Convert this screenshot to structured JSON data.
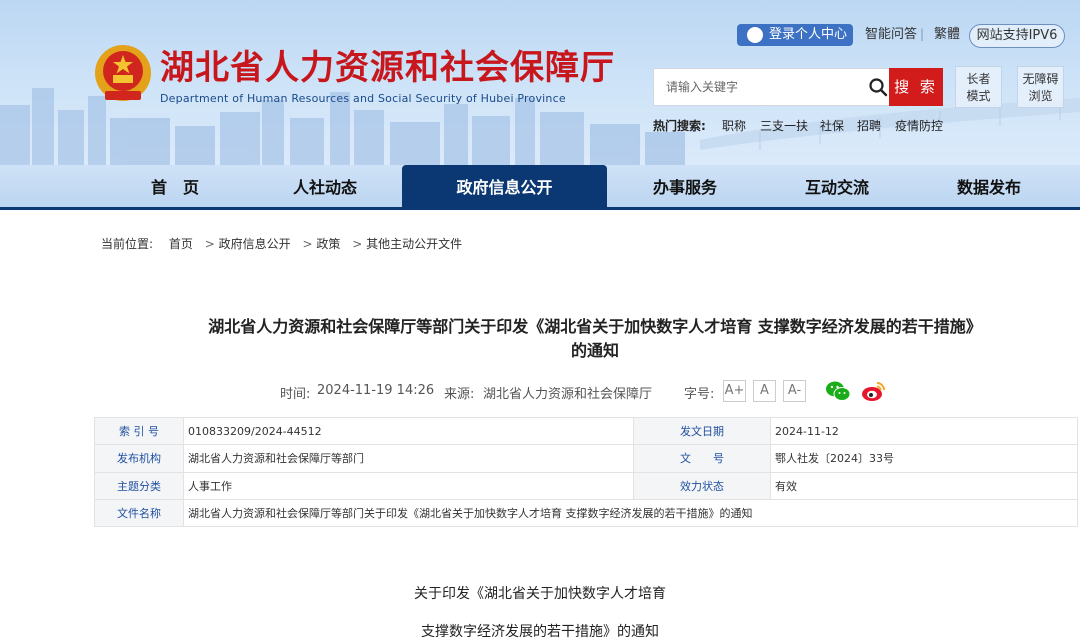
{
  "header": {
    "title_cn": "湖北省人力资源和社会保障厅",
    "title_en": "Department of Human Resources and Social Security of Hubei Province",
    "login_label": "登录个人中心",
    "links": [
      "智能问答",
      "繁體"
    ],
    "ipv6_label": "网站支持IPV6",
    "search_placeholder": "请输入关键字",
    "search_button": "搜 索",
    "elder_mode": [
      "长者",
      "模式"
    ],
    "accessible_mode": [
      "无障碍",
      "浏览"
    ],
    "hot_label": "热门搜索:",
    "hot_items": [
      "职称",
      "三支一扶",
      "社保",
      "招聘",
      "疫情防控"
    ]
  },
  "nav": {
    "items": [
      "首　页",
      "人社动态",
      "政府信息公开",
      "办事服务",
      "互动交流",
      "数据发布"
    ],
    "active_index": 2
  },
  "breadcrumb": {
    "label": "当前位置:",
    "items": [
      "首页",
      "政府信息公开",
      "政策",
      "其他主动公开文件"
    ]
  },
  "article": {
    "title_line1": "湖北省人力资源和社会保障厅等部门关于印发《湖北省关于加快数字人才培育 支撑数字经济发展的若干措施》",
    "title_line2": "的通知",
    "time_label": "时间:",
    "time_value": "2024-11-19 14:26",
    "source_label": "来源:",
    "source_value": "湖北省人力资源和社会保障厅",
    "font_label": "字号:",
    "font_buttons": [
      "A+",
      "A",
      "A-"
    ],
    "body_line1": "关于印发《湖北省关于加快数字人才培育",
    "body_line2": "支撑数字经济发展的若干措施》的通知"
  },
  "info_table": {
    "index_label": "索 引 号",
    "index_value": "010833209/2024-44512",
    "date_label": "发文日期",
    "date_value": "2024-11-12",
    "issuer_label": "发布机构",
    "issuer_value": "湖北省人力资源和社会保障厅等部门",
    "doc_no_label": "文　　号",
    "doc_no_value": "鄂人社发〔2024〕33号",
    "topic_label": "主题分类",
    "topic_value": "人事工作",
    "status_label": "效力状态",
    "status_value": "有效",
    "file_name_label": "文件名称",
    "file_name_value": "湖北省人力资源和社会保障厅等部门关于印发《湖北省关于加快数字人才培育 支撑数字经济发展的若干措施》的通知"
  },
  "colors": {
    "brand_red": "#c8161d",
    "nav_active": "#0b3873",
    "search_red": "#d21c1c",
    "label_blue": "#2050a0"
  },
  "icons": [
    "emblem-icon",
    "user-icon",
    "search-icon",
    "wechat-icon",
    "weibo-icon"
  ]
}
